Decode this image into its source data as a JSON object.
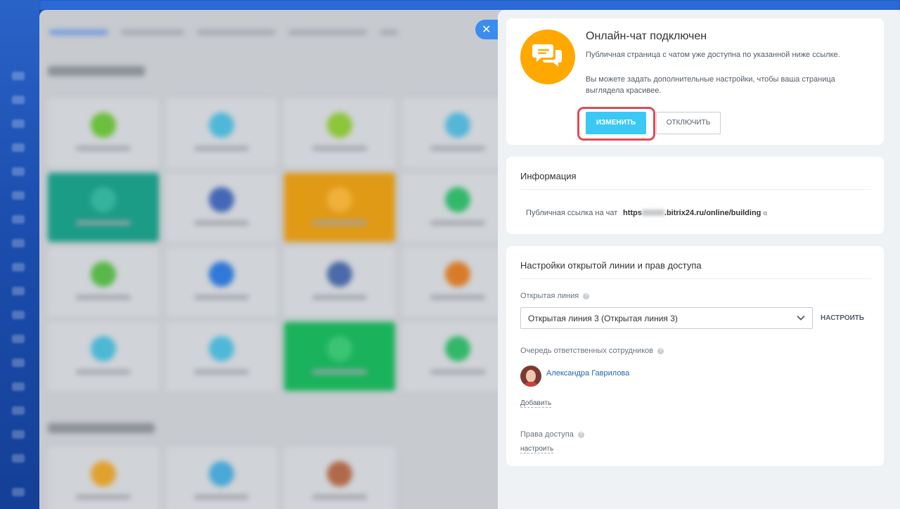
{
  "background": {
    "sidebar_color": "#1c4fb0",
    "main_color": "#c7cacf"
  },
  "close_button": {
    "icon": "close-icon",
    "glyph": "✕"
  },
  "status_card": {
    "icon": "chat-bubbles-icon",
    "icon_color": "#ffa900",
    "title": "Онлайн-чат подключен",
    "description1": "Публичная страница с чатом уже доступна по указанной ниже ссылке.",
    "description2": "Вы можете задать дополнительные настройки, чтобы ваша страница выглядела красивее.",
    "change_label": "ИЗМЕНИТЬ",
    "disable_label": "ОТКЛЮЧИТЬ",
    "highlight_color": "#e44a52",
    "primary_color": "#3bc8f5"
  },
  "info_card": {
    "title": "Информация",
    "link_label": "Публичная ссылка на чат",
    "link_prefix": "https",
    "link_suffix": ".bitrix24.ru/online/building"
  },
  "settings_card": {
    "title": "Настройки открытой линии и прав доступа",
    "open_line_label": "Открытая линия",
    "open_line_value": "Открытая линия 3 (Открытая линия 3)",
    "configure_label": "НАСТРОИТЬ",
    "queue_label": "Очередь ответственных сотрудников",
    "queue_user": "Александра Гаврилова",
    "add_label": "Добавить",
    "access_label": "Права доступа",
    "access_configure_label": "настроить",
    "help_glyph": "?",
    "link_color": "#2067b0"
  }
}
